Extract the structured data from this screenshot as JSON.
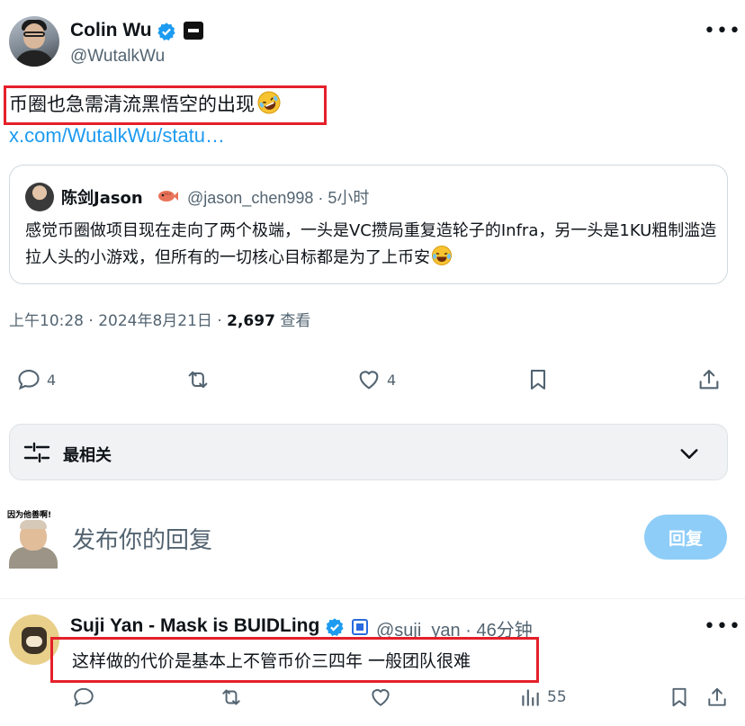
{
  "tweet": {
    "author_name": "Colin Wu",
    "author_handle": "@WutalkWu",
    "text": "币圈也急需清流黑悟空的出现",
    "link": "x.com/WutalkWu/statu…",
    "quote": {
      "author_name": "陈剑Jason",
      "author_handle": "@jason_chen998 · 5小时",
      "text": "感觉币圈做项目现在走向了两个极端，一头是VC攒局重复造轮子的Infra，另一头是1KU粗制滥造拉人头的小游戏，但所有的一切核心目标都是为了上币安"
    },
    "timestamp": "上午10:28 · 2024年8月21日 · ",
    "views_count": "2,697",
    "views_label": " 查看",
    "stats": {
      "replies": "4",
      "likes": "4"
    }
  },
  "sort": {
    "label": "最相关"
  },
  "composer": {
    "avatar_caption": "因为他善啊!",
    "placeholder": "发布你的回复",
    "reply_button": "回复"
  },
  "reply": {
    "author_name": "Suji Yan - Mask is BUIDLing",
    "author_handle": "@suji_yan · 46分钟",
    "text": "这样做的代价是基本上不管币价三四年 一般团队很难",
    "views": "55"
  },
  "colors": {
    "accent": "#1d9bf0",
    "highlight_box": "#e4202a",
    "muted_text": "#536471"
  }
}
